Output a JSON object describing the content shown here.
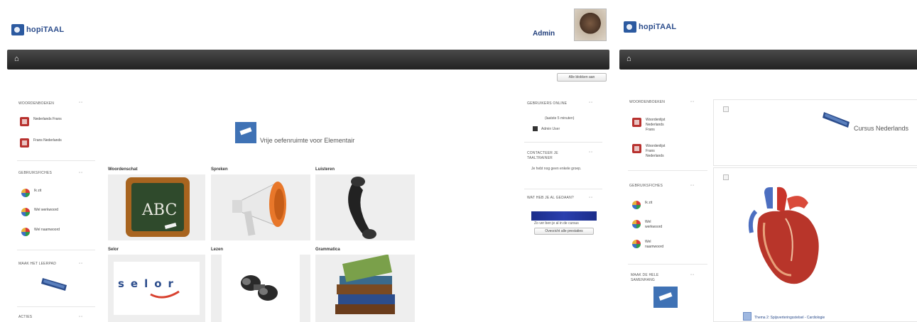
{
  "left": {
    "logo_text": "hopiTAAL",
    "admin_label": "Admin",
    "hide_button": "Alle blokken aan",
    "blocks_left": [
      {
        "title": "Woordenboeken",
        "items": [
          "Nederlands Frans",
          "Frans Nederlands"
        ]
      },
      {
        "title": "Gebruiksfiches",
        "items": [
          "Ik zit",
          "Wel werkwoord",
          "Wel naamwoord"
        ]
      },
      {
        "title": "Maak het leerpad"
      },
      {
        "title": "Acties"
      }
    ],
    "center_title": "Vrije oefenruimte voor Elementair",
    "tiles": [
      {
        "label": "Woordenschat",
        "icon": "abc-chalkboard-icon"
      },
      {
        "label": "Spreken",
        "icon": "megaphone-icon"
      },
      {
        "label": "Luisteren",
        "icon": "telephone-icon"
      },
      {
        "label": "Selor",
        "icon": "selor-logo-icon"
      },
      {
        "label": "Lezen",
        "icon": "binoculars-icon"
      },
      {
        "label": "Grammatica",
        "icon": "books-icon"
      }
    ],
    "blocks_right": [
      {
        "title": "Gebruikers online",
        "subtitle": "(laatste 5 minuten)",
        "user": "Admin User"
      },
      {
        "title": "Contacteer je taaltrainer",
        "text": "Je hebt nog geen enkele groep."
      },
      {
        "title": "Wat heb je al gedaan?",
        "caption": "Zo ver ben je al in de cursus",
        "button": "Overzicht alle prestaties"
      }
    ]
  },
  "right": {
    "logo_text": "hopiTAAL",
    "blocks": [
      {
        "title": "Woordenboeken",
        "items": [
          "Woordenlijst Nederlands Frans",
          "Woordenlijst Frans Nederlands"
        ]
      },
      {
        "title": "Gebruiksfiches",
        "items": [
          "Ik zit",
          "Wel werkwoord",
          "Wel naamwoord"
        ]
      },
      {
        "title": "Maak de Hele Samenhang"
      }
    ],
    "course_title": "Cursus Nederlands",
    "bottom_link": "Thema 2: Spijsverteringsstelsel - Cardiologie"
  },
  "colors": {
    "navbar": "#222222",
    "brand_blue": "#2c5aa0",
    "dict_icon_red": "#b8322f",
    "progress_bar": "#1b2d8a"
  }
}
